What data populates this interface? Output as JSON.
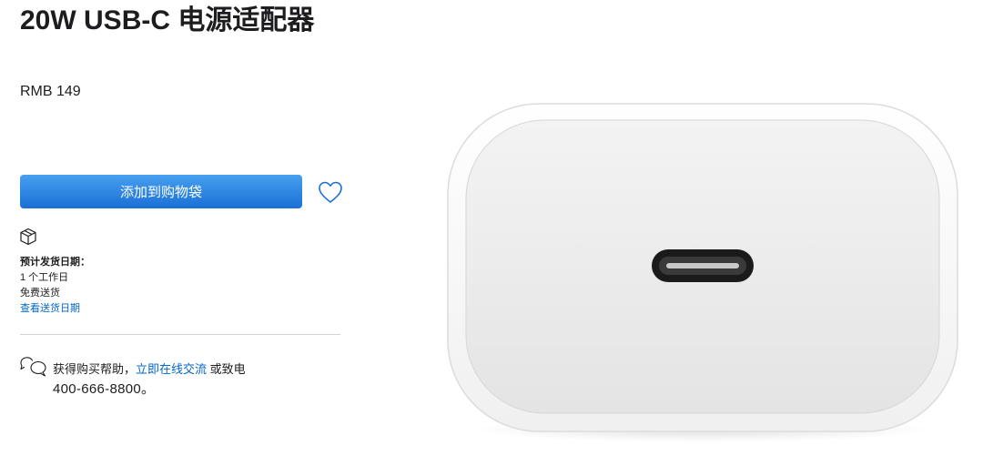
{
  "product": {
    "title": "20W USB-C 电源适配器",
    "price": "RMB 149"
  },
  "actions": {
    "add_to_bag_label": "添加到购物袋"
  },
  "shipping": {
    "heading": "预计发货日期：",
    "eta": "1 个工作日",
    "fee": "免费送货",
    "link": "查看送货日期"
  },
  "help": {
    "prefix": "获得购买帮助，",
    "chat_link": "立即在线交流",
    "suffix": " 或致电",
    "phone": "400-666-8800。"
  },
  "colors": {
    "button": "#1a6fd6",
    "link": "#0066cc",
    "text": "#1d1d1f"
  }
}
